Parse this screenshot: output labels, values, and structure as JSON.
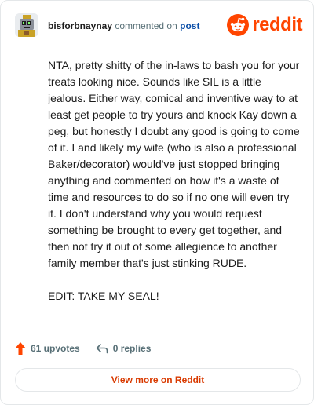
{
  "colors": {
    "brand": "#ff4500",
    "link": "#0a4ea8",
    "muted": "#576f76",
    "cta": "#d93a00",
    "border": "#e4e7e9"
  },
  "header": {
    "avatar_icon": "robot-avatar-icon",
    "username": "bisforbnaynay",
    "action_text": "commented on",
    "post_link": "post",
    "logo_icon": "reddit-snoo-icon",
    "logo_text": "reddit"
  },
  "comment": {
    "paragraphs": [
      "NTA, pretty shitty of the in-laws to bash you for your treats looking nice. Sounds like SIL is a little jealous. Either way, comical and inventive way to at least get people to try yours and knock Kay down a peg, but honestly I doubt any good is going to come of it. I and likely my wife (who is also a professional Baker/decorator) would've just stopped bringing anything and commented on how it's a waste of time and resources to do so if no one will even try it. I don't understand why you would request something be brought to every get together, and then not try it out of some allegience to another family member that's just stinking RUDE.",
      "EDIT: TAKE MY SEAL!"
    ]
  },
  "actions": {
    "upvote_icon": "upvote-arrow-icon",
    "upvotes_label": "61 upvotes",
    "reply_icon": "reply-arrow-icon",
    "replies_label": "0 replies"
  },
  "cta": {
    "label": "View more on Reddit"
  }
}
